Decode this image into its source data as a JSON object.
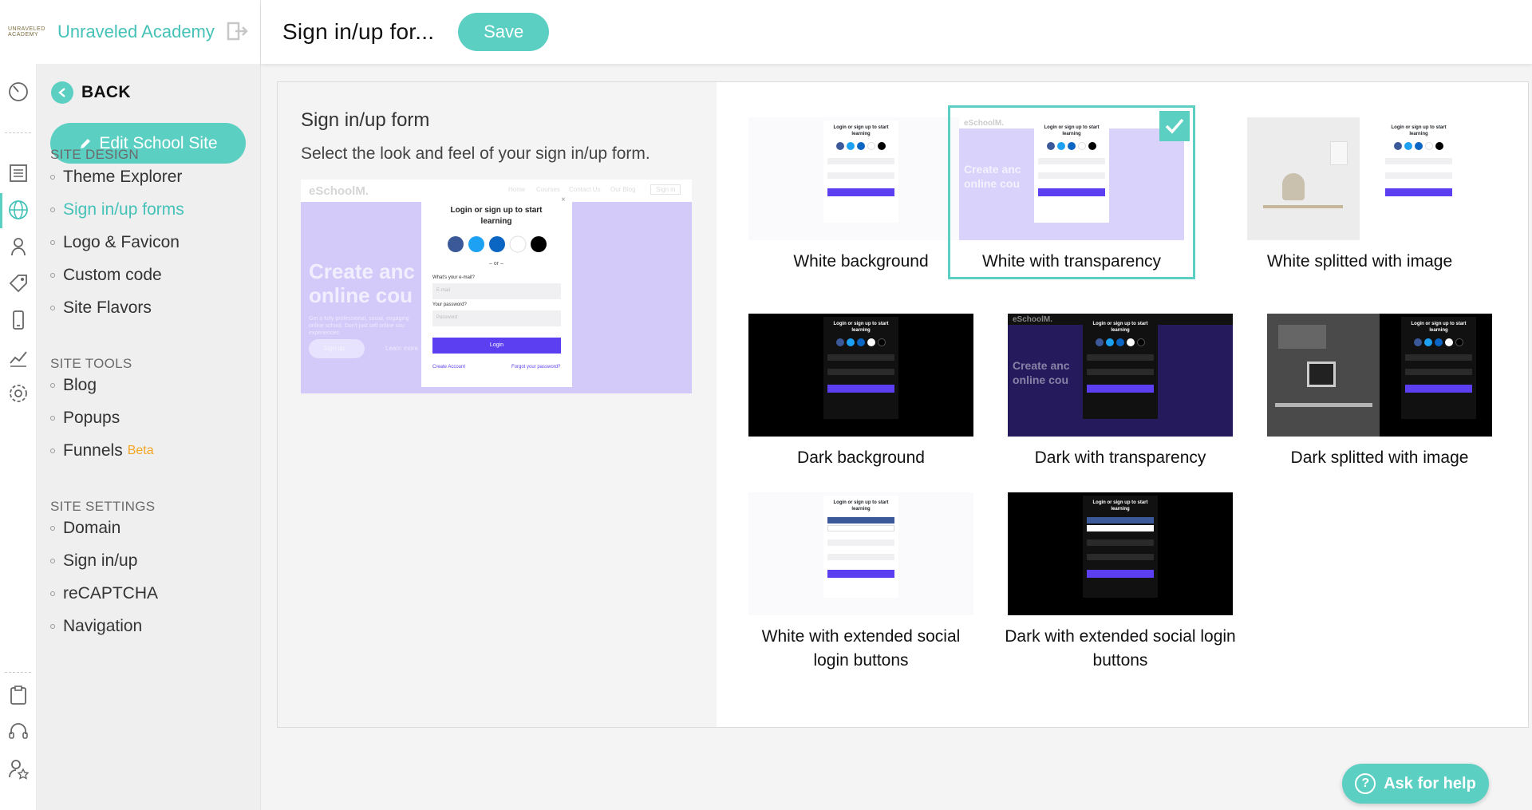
{
  "brand": {
    "mini_logo_text": "UNRAVELED ACADEMY",
    "name": "Unraveled Academy"
  },
  "header": {
    "title": "Sign in/up for...",
    "save_label": "Save"
  },
  "nav": {
    "back_label": "BACK",
    "edit_site_label": "Edit School Site",
    "sections": [
      {
        "title": "SITE DESIGN",
        "items": [
          "Theme Explorer",
          "Sign in/up forms",
          "Logo & Favicon",
          "Custom code",
          "Site Flavors"
        ]
      },
      {
        "title": "SITE TOOLS",
        "items": [
          "Blog",
          "Popups",
          "Funnels"
        ]
      },
      {
        "title": "SITE SETTINGS",
        "items": [
          "Domain",
          "Sign in/up",
          "reCAPTCHA",
          "Navigation"
        ]
      }
    ],
    "active_item": "Sign in/up forms",
    "beta_label": "Beta"
  },
  "main": {
    "title": "Sign in/up form",
    "description": "Select the look and feel of your sign in/up form.",
    "preview": {
      "site_logo": "eSchoolM.",
      "nav_links": [
        "Home",
        "Courses",
        "Contact Us",
        "Our Blog"
      ],
      "nav_button": "Sign in",
      "hero_line1": "Create anc",
      "hero_line2": "online cou",
      "hero_body": "Get a fully professional, social, engaging online school. Don't just sell online cou experiences",
      "hero_button": "Sign up",
      "hero_link": "Learn more",
      "form_title": "Login or sign up to start learning",
      "or_label": "– or –",
      "email_label": "What's your e-mail?",
      "email_placeholder": "E-mail",
      "password_label": "Your password?",
      "password_placeholder": "Password",
      "login_button": "Login",
      "create_account": "Create Account",
      "forgot_password": "Forgot your password?"
    },
    "options": [
      {
        "label": "White background",
        "style": "white"
      },
      {
        "label": "White with transparency",
        "style": "white-transparent",
        "selected": true
      },
      {
        "label": "White splitted with image",
        "style": "white-split"
      },
      {
        "label": "Dark background",
        "style": "dark"
      },
      {
        "label": "Dark with transparency",
        "style": "dark-transparent"
      },
      {
        "label": "Dark splitted with image",
        "style": "dark-split"
      },
      {
        "label": "White with extended social login buttons",
        "style": "white-extended"
      },
      {
        "label": "Dark with extended social login buttons",
        "style": "dark-extended"
      }
    ]
  },
  "help": {
    "label": "Ask for help"
  },
  "colors": {
    "accent": "#5ccfc3",
    "accent_text": "#45c2b8",
    "form_button": "#5b3ff0",
    "beta": "#f5a623"
  }
}
